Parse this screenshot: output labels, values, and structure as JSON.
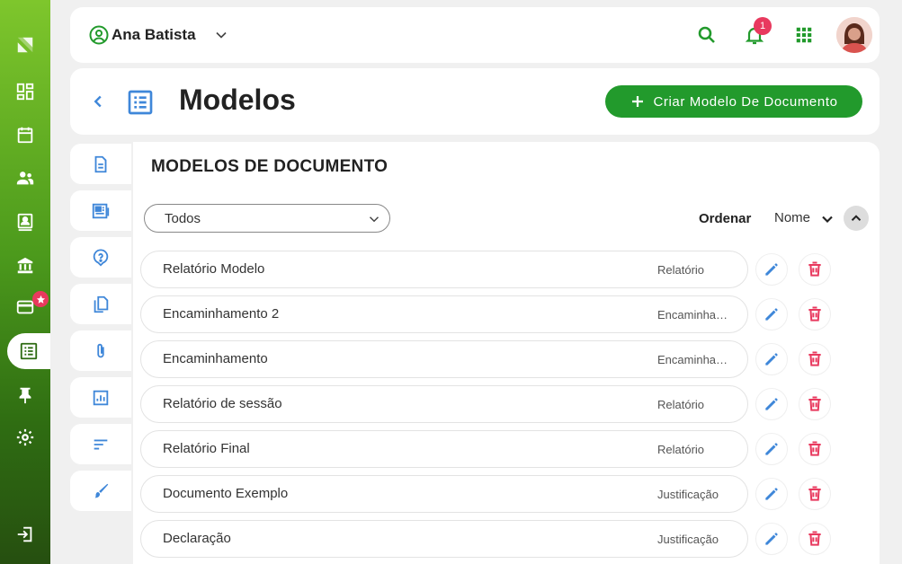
{
  "user": {
    "name": "Ana Batista"
  },
  "notifications": {
    "count": "1"
  },
  "page": {
    "title": "Modelos",
    "create_button": "Criar Modelo De Documento"
  },
  "section": {
    "title": "MODELOS DE DOCUMENTO"
  },
  "filter": {
    "selected": "Todos"
  },
  "sort": {
    "label": "Ordenar",
    "value": "Nome"
  },
  "rows": [
    {
      "name": "Relatório Modelo",
      "type": "Relatório"
    },
    {
      "name": "Encaminhamento 2",
      "type": "Encaminhamento"
    },
    {
      "name": "Encaminhamento",
      "type": "Encaminhamento"
    },
    {
      "name": "Relatório de sessão",
      "type": "Relatório"
    },
    {
      "name": "Relatório Final",
      "type": "Relatório"
    },
    {
      "name": "Documento Exemplo",
      "type": "Justificação"
    },
    {
      "name": "Declaração",
      "type": "Justificação"
    }
  ],
  "colors": {
    "brand_green": "#229a2c",
    "icon_blue": "#3f87d9",
    "delete_red": "#e8395e",
    "rail_green": "#4c9a1c"
  },
  "icons": {
    "rail": [
      "logo-icon",
      "dashboard-icon",
      "calendar-icon",
      "people-icon",
      "contact-card-icon",
      "bank-icon",
      "credit-card-icon",
      "list-icon",
      "pin-icon",
      "settings-icon",
      "logout-icon"
    ],
    "side_tabs": [
      "document-icon",
      "newspaper-icon",
      "help-icon",
      "copy-icon",
      "attachment-icon",
      "chart-icon",
      "sort-lines-icon",
      "brush-icon"
    ]
  }
}
